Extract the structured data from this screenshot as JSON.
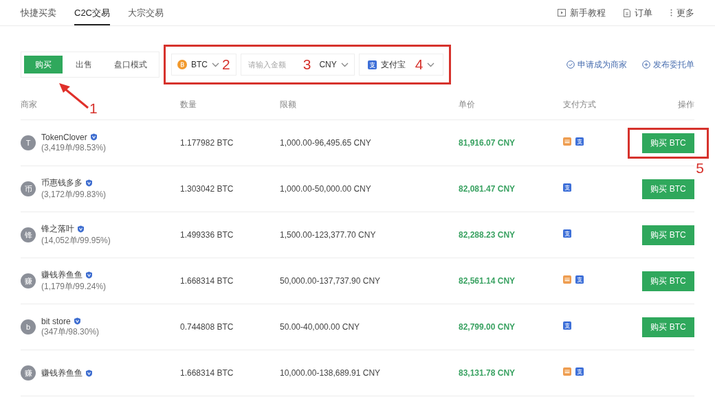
{
  "nav": {
    "tabs": [
      {
        "label": "快捷买卖",
        "selected": false
      },
      {
        "label": "C2C交易",
        "selected": true
      },
      {
        "label": "大宗交易",
        "selected": false
      }
    ],
    "links": [
      {
        "label": "新手教程",
        "kind": "tutorial"
      },
      {
        "label": "订单",
        "kind": "orders"
      },
      {
        "label": "更多",
        "kind": "more"
      }
    ]
  },
  "mode_tabs": {
    "marker": "1",
    "items": [
      {
        "label": "购买",
        "selected": true
      },
      {
        "label": "出售",
        "selected": false
      },
      {
        "label": "盘口模式",
        "selected": false
      }
    ]
  },
  "filters": {
    "highlighted": true,
    "coin": {
      "label": "BTC",
      "marker": "2"
    },
    "amount": {
      "placeholder": "请输入金额",
      "currency": "CNY",
      "marker": "3"
    },
    "payment": {
      "label": "支付宝",
      "marker": "4"
    }
  },
  "actions": [
    {
      "label": "申请成为商家",
      "kind": "apply"
    },
    {
      "label": "发布委托单",
      "kind": "post"
    }
  ],
  "table": {
    "columns": [
      "商家",
      "数量",
      "限额",
      "单价",
      "支付方式",
      "操作"
    ],
    "rows": [
      {
        "avatar": "T",
        "merchant": "TokenClover",
        "stats": "(3,419单/98.53%)",
        "amount": "1.177982 BTC",
        "limit": "1,000.00-96,495.65 CNY",
        "price": "81,916.07 CNY",
        "payments": [
          {
            "kind": "bank"
          },
          {
            "kind": "alipay"
          }
        ],
        "button": "购买 BTC",
        "highlighted": true,
        "marker": "5"
      },
      {
        "avatar": "币",
        "merchant": "币惠钱多多",
        "stats": "(3,172单/99.83%)",
        "amount": "1.303042 BTC",
        "limit": "1,000.00-50,000.00 CNY",
        "price": "82,081.47 CNY",
        "payments": [
          {
            "kind": "alipay"
          }
        ],
        "button": "购买 BTC",
        "highlighted": false
      },
      {
        "avatar": "锋",
        "merchant": "锋之落叶",
        "stats": "(14,052单/99.95%)",
        "amount": "1.499336 BTC",
        "limit": "1,500.00-123,377.70 CNY",
        "price": "82,288.23 CNY",
        "payments": [
          {
            "kind": "alipay"
          }
        ],
        "button": "购买 BTC",
        "highlighted": false
      },
      {
        "avatar": "赚",
        "merchant": "赚钱养鱼鱼",
        "stats": "(1,179单/99.24%)",
        "amount": "1.668314 BTC",
        "limit": "50,000.00-137,737.90 CNY",
        "price": "82,561.14 CNY",
        "payments": [
          {
            "kind": "bank"
          },
          {
            "kind": "alipay"
          }
        ],
        "button": "购买 BTC",
        "highlighted": false
      },
      {
        "avatar": "b",
        "merchant": "bit store",
        "stats": "(347单/98.30%)",
        "amount": "0.744808 BTC",
        "limit": "50.00-40,000.00 CNY",
        "price": "82,799.00 CNY",
        "payments": [
          {
            "kind": "alipay"
          }
        ],
        "button": "购买 BTC",
        "highlighted": false
      },
      {
        "avatar": "赚",
        "merchant": "赚钱养鱼鱼",
        "amount": "1.668314 BTC",
        "limit": "10,000.00-138,689.91 CNY",
        "price": "83,131.78 CNY",
        "payments": [
          {
            "kind": "bank"
          },
          {
            "kind": "alipay"
          }
        ],
        "highlighted": false
      }
    ]
  }
}
